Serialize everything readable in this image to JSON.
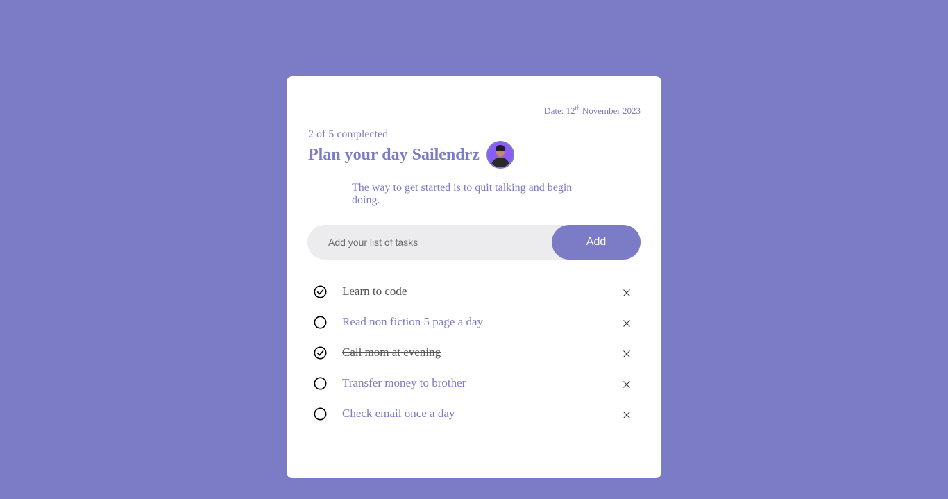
{
  "header": {
    "date_prefix": "Date: 12",
    "date_sup": "th",
    "date_suffix": " November 2023",
    "progress": "2 of 5 complected",
    "title": "Plan your day Sailendrz",
    "quote": "The way to get started is to quit talking and begin doing."
  },
  "form": {
    "placeholder": "Add your list of tasks",
    "value": "",
    "add_label": "Add"
  },
  "tasks": [
    {
      "label": "Learn to code",
      "done": true
    },
    {
      "label": "Read non fiction 5 page a day",
      "done": false
    },
    {
      "label": "Call mom at evening",
      "done": true
    },
    {
      "label": "Transfer money to brother",
      "done": false
    },
    {
      "label": "Check email once a day",
      "done": false
    }
  ],
  "colors": {
    "background": "#7c7cc6",
    "accent": "#7c7cc6",
    "card": "#ffffff",
    "input_bg": "#ececee",
    "done_text": "#555555"
  },
  "icons": {
    "checked": "check-circle-icon",
    "unchecked": "circle-icon",
    "delete": "close-icon",
    "avatar": "user-avatar"
  }
}
